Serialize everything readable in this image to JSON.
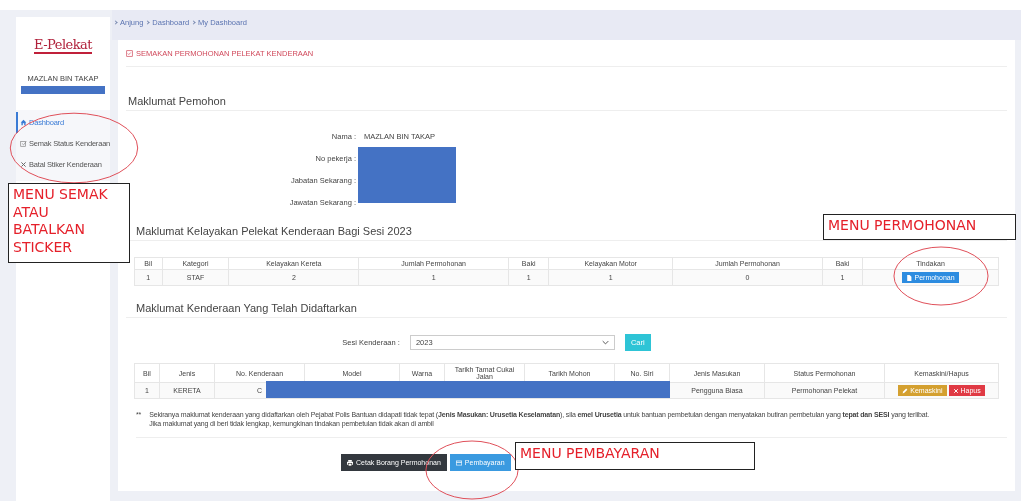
{
  "sidebar": {
    "logo": "E-Pelekat",
    "user": "MAZLAN BIN TAKAP",
    "items": [
      {
        "label": "Dashboard",
        "selected": true
      },
      {
        "label": "Semak Status Kenderaan",
        "selected": false
      },
      {
        "label": "Batal Stiker Kenderaan",
        "selected": false
      }
    ]
  },
  "breadcrumb": [
    "Anjung",
    "Dashboard",
    "My Dashboard"
  ],
  "page_title": "SEMAKAN PERMOHONAN PELEKAT KENDERAAN",
  "applicant": {
    "title": "Maklumat Pemohon",
    "fields": [
      {
        "label": "Nama :",
        "value": "MAZLAN BIN TAKAP"
      },
      {
        "label": "No pekerja :"
      },
      {
        "label": "Jabatan Sekarang :"
      },
      {
        "label": "Jawatan Sekarang :"
      }
    ]
  },
  "eligibility": {
    "title": "Maklumat Kelayakan Pelekat Kenderaan Bagi Sesi 2023",
    "columns": [
      "Bil",
      "Kategori",
      "Kelayakan Kereta",
      "Jumlah Permohonan",
      "Baki",
      "Kelayakan Motor",
      "Jumlah Permohonan",
      "Baki",
      "Tindakan"
    ],
    "rows": [
      {
        "cells": [
          "1",
          "STAF",
          "2",
          "1",
          "1",
          "1",
          "0",
          "1"
        ],
        "action": "Permohonan"
      }
    ]
  },
  "vehicles": {
    "title": "Maklumat Kenderaan Yang Telah Didaftarkan",
    "filter": {
      "label": "Sesi Kenderaan :",
      "value": "2023"
    },
    "search_button": "Cari",
    "columns": [
      "Bil",
      "Jenis",
      "No. Kenderaan",
      "Model",
      "Warna",
      "Tarikh Tamat Cukai Jalan",
      "Tarikh Mohon",
      "No. Siri",
      "Jenis Masukan",
      "Status Permohonan",
      "Kemaskini/Hapus"
    ],
    "rows": [
      {
        "bil": "1",
        "jenis": "KERETA",
        "no_kenderaan": "C",
        "jenis_masukan": "Pengguna Biasa",
        "status": "Permohonan Pelekat",
        "actions": [
          {
            "label": "Kemaskini",
            "kind": "edit"
          },
          {
            "label": "Hapus",
            "kind": "delete"
          }
        ]
      }
    ]
  },
  "notes": {
    "mark": "**",
    "lines": [
      "Sekiranya maklumat kenderaan yang didaftarkan oleh Pejabat Polis Bantuan didapati tidak tepat (**Jenis Masukan: Urusetia Keselamatan**), sila **emel Urusetia** untuk bantuan pembetulan dengan menyatakan butiran pembetulan yang **tepat dan SESI** yang terlibat.",
      "Jika maklumat yang di beri tidak lengkap, kemungkinan tindakan pembetulan tidak akan di ambil"
    ]
  },
  "buttons": [
    {
      "label": "Cetak Borang Permohonan",
      "kind": "print"
    },
    {
      "label": "Pembayaran",
      "kind": "payment"
    }
  ],
  "annotations": [
    {
      "text": "MENU SEMAK ATAU BATALKAN STICKER",
      "kind": "sidebar"
    },
    {
      "text": "MENU PERMOHONAN",
      "kind": "action"
    },
    {
      "text": "MENU PEMBAYARAN",
      "kind": "payment"
    }
  ]
}
